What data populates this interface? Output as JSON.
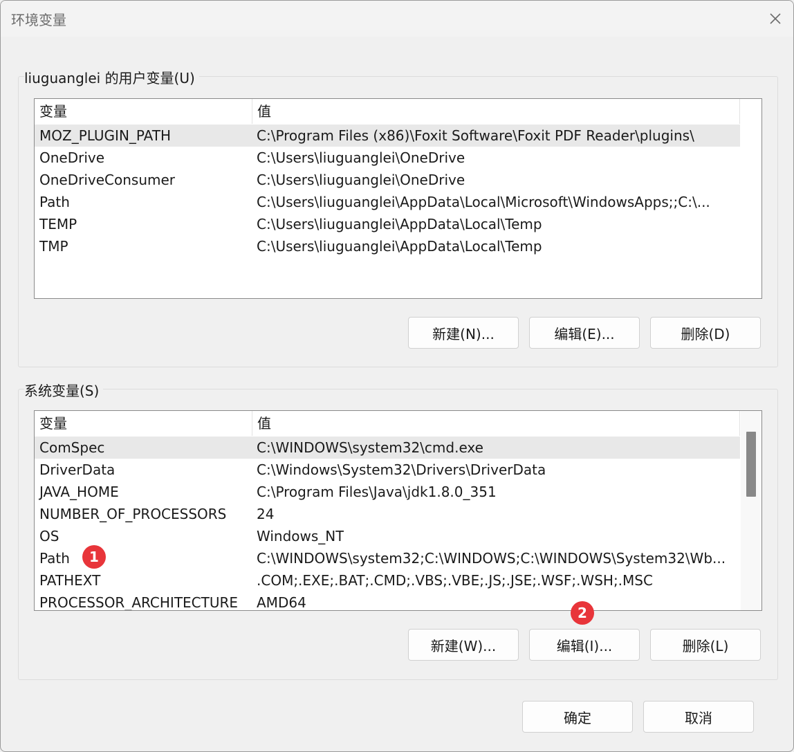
{
  "window": {
    "title": "环境变量"
  },
  "user_vars": {
    "group_label": "liuguanglei 的用户变量(U)",
    "columns": {
      "name": "变量",
      "value": "值"
    },
    "rows": [
      {
        "name": "MOZ_PLUGIN_PATH",
        "value": "C:\\Program Files (x86)\\Foxit Software\\Foxit PDF Reader\\plugins\\"
      },
      {
        "name": "OneDrive",
        "value": "C:\\Users\\liuguanglei\\OneDrive"
      },
      {
        "name": "OneDriveConsumer",
        "value": "C:\\Users\\liuguanglei\\OneDrive"
      },
      {
        "name": "Path",
        "value": "C:\\Users\\liuguanglei\\AppData\\Local\\Microsoft\\WindowsApps;;C:\\..."
      },
      {
        "name": "TEMP",
        "value": "C:\\Users\\liuguanglei\\AppData\\Local\\Temp"
      },
      {
        "name": "TMP",
        "value": "C:\\Users\\liuguanglei\\AppData\\Local\\Temp"
      }
    ],
    "buttons": {
      "new": "新建(N)...",
      "edit": "编辑(E)...",
      "delete": "删除(D)"
    }
  },
  "system_vars": {
    "group_label": "系统变量(S)",
    "columns": {
      "name": "变量",
      "value": "值"
    },
    "rows": [
      {
        "name": "ComSpec",
        "value": "C:\\WINDOWS\\system32\\cmd.exe"
      },
      {
        "name": "DriverData",
        "value": "C:\\Windows\\System32\\Drivers\\DriverData"
      },
      {
        "name": "JAVA_HOME",
        "value": "C:\\Program Files\\Java\\jdk1.8.0_351"
      },
      {
        "name": "NUMBER_OF_PROCESSORS",
        "value": "24"
      },
      {
        "name": "OS",
        "value": "Windows_NT"
      },
      {
        "name": "Path",
        "value": "C:\\WINDOWS\\system32;C:\\WINDOWS;C:\\WINDOWS\\System32\\Wb..."
      },
      {
        "name": "PATHEXT",
        "value": ".COM;.EXE;.BAT;.CMD;.VBS;.VBE;.JS;.JSE;.WSF;.WSH;.MSC"
      },
      {
        "name": "PROCESSOR_ARCHITECTURE",
        "value": "AMD64"
      }
    ],
    "buttons": {
      "new": "新建(W)...",
      "edit": "编辑(I)...",
      "delete": "删除(L)"
    }
  },
  "dialog_buttons": {
    "ok": "确定",
    "cancel": "取消"
  },
  "badges": {
    "first": "1",
    "second": "2"
  },
  "colors": {
    "badge": "#e8353a",
    "selected_row": "#e8e8e8"
  },
  "icons": {
    "close": "close-icon"
  }
}
